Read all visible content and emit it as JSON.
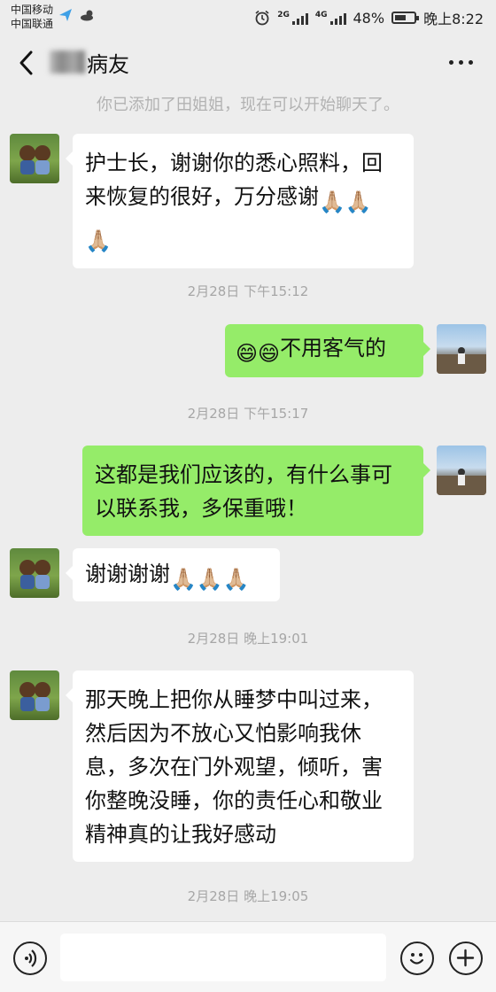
{
  "status_bar": {
    "carrier_1": "中国移动",
    "carrier_2": "中国联通",
    "network_1": "2G",
    "network_2": "4G",
    "battery": "48%",
    "time": "晚上8:22"
  },
  "header": {
    "title": "病友",
    "back_icon": "chevron-left-icon",
    "more_icon": "more-dots-icon"
  },
  "chat": {
    "system_note": "你已添加了田姐姐，现在可以开始聊天了。",
    "messages": [
      {
        "sender": "friend",
        "text": "护士长，谢谢你的悉心照料，回来恢复的很好，万分感谢",
        "emoji": [
          "🙏🏼",
          "🙏🏼",
          "🙏🏼"
        ]
      },
      {
        "timestamp": "2月28日 下午15:12"
      },
      {
        "sender": "self",
        "emoji_prefix": [
          "😄",
          "😄"
        ],
        "text": "不用客气的"
      },
      {
        "timestamp": "2月28日 下午15:17"
      },
      {
        "sender": "self",
        "text": "这都是我们应该的，有什么事可以联系我，多保重哦！"
      },
      {
        "sender": "friend",
        "text": "谢谢谢谢",
        "emoji": [
          "🙏🏼",
          "🙏🏼",
          "🙏🏼"
        ]
      },
      {
        "timestamp": "2月28日 晚上19:01"
      },
      {
        "sender": "friend",
        "text": "那天晚上把你从睡梦中叫过来，然后因为不放心又怕影响我休息，多次在门外观望，倾听，害你整晚没睡，你的责任心和敬业精神真的让我好感动"
      },
      {
        "timestamp": "2月28日 晚上19:05"
      }
    ]
  },
  "input_bar": {
    "voice_icon": "voice-icon",
    "emoji_icon": "emoji-smile-icon",
    "plus_icon": "plus-icon",
    "input_value": ""
  },
  "colors": {
    "background": "#ededed",
    "outgoing_bubble": "#95ec69",
    "incoming_bubble": "#ffffff"
  }
}
